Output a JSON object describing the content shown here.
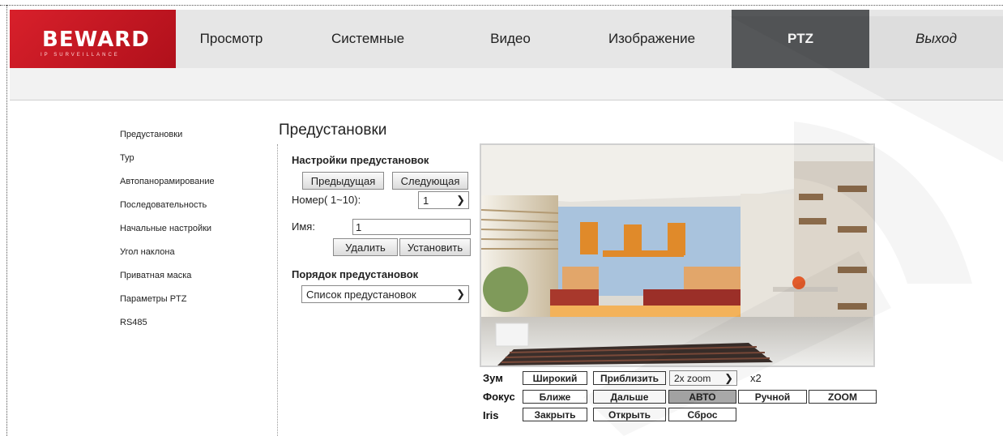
{
  "brand": {
    "name": "BEWARD",
    "tagline": "IP SURVEILLANCE"
  },
  "nav": [
    {
      "label": "Просмотр"
    },
    {
      "label": "Системные"
    },
    {
      "label": "Видео"
    },
    {
      "label": "Изображение"
    },
    {
      "label": "PTZ",
      "active": true
    },
    {
      "label": "Выход"
    }
  ],
  "sidebar": [
    {
      "label": "Предустановки"
    },
    {
      "label": "Тур"
    },
    {
      "label": "Автопанорамирование"
    },
    {
      "label": "Последовательность"
    },
    {
      "label": "Начальные настройки"
    },
    {
      "label": "Угол наклона"
    },
    {
      "label": "Приватная маска"
    },
    {
      "label": "Параметры PTZ"
    },
    {
      "label": "RS485"
    }
  ],
  "page_title": "Предустановки",
  "preset_settings": {
    "title": "Настройки предустановок",
    "prev_label": "Предыдущая",
    "next_label": "Следующая",
    "number_label": "Номер( 1~10):",
    "number_value": "1",
    "name_label": "Имя:",
    "name_value": "1",
    "delete_label": "Удалить",
    "set_label": "Установить"
  },
  "preset_order": {
    "title": "Порядок предустановок",
    "list_value": "Список предустановок"
  },
  "ptz": {
    "zoom_label": "Зум",
    "wide_label": "Широкий",
    "tele_label": "Приблизить",
    "zoom_select": "2x zoom",
    "zoom_value": "x2",
    "focus_label": "Фокус",
    "near_label": "Ближе",
    "far_label": "Дальше",
    "auto_label": "АВТО",
    "manual_label": "Ручной",
    "zoomfocus_label": "ZOOM",
    "iris_label": "Iris",
    "close_label": "Закрыть",
    "open_label": "Открыть",
    "reset_label": "Сброс"
  },
  "colors": {
    "brand": "#c8161f",
    "nav_active": "#555759",
    "nav_bg": "#e6e6e6"
  }
}
